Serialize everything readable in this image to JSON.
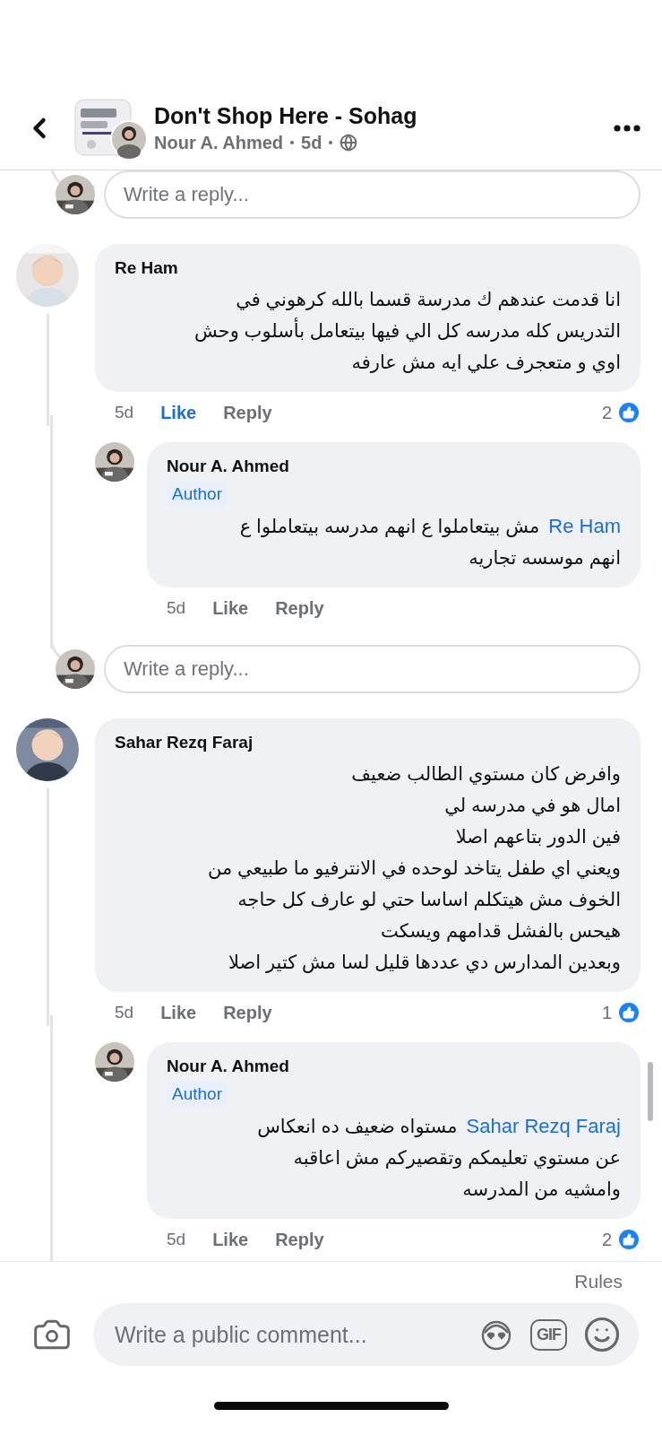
{
  "header": {
    "title": "Don't Shop Here - Sohag",
    "author": "Nour A. Ahmed",
    "time": "5d"
  },
  "thread": [
    {
      "kind": "reply_box",
      "placeholder": "Write a reply..."
    },
    {
      "kind": "comment",
      "name": "Re Ham",
      "text": "انا قدمت عندهم ك مدرسة قسما بالله كرهوني في\nالتدريس كله مدرسه كل الي فيها بيتعامل بأسلوب وحش\nاوي و متعجرف علي ايه مش عارفه",
      "time": "5d",
      "like": "Like",
      "liked": true,
      "reply": "Reply",
      "reactions": "2"
    },
    {
      "kind": "reply",
      "name": "Nour A. Ahmed",
      "badge": "Author",
      "mention": "Re Ham",
      "text": "مش بيتعاملوا ع انهم مدرسه بيتعاملوا ع\nانهم موسسه تجاريه",
      "time": "5d",
      "like": "Like",
      "liked": false,
      "reply": "Reply"
    },
    {
      "kind": "reply_box",
      "placeholder": "Write a reply..."
    },
    {
      "kind": "comment",
      "name": "Sahar Rezq Faraj",
      "text": "وافرض كان مستوي الطالب ضعيف\nامال هو في مدرسه لي\nفين الدور بتاعهم اصلا\nويعني اي طفل يتاخد لوحده في الانترفيو ما طبيعي من\nالخوف مش هيتكلم اساسا حتي لو عارف كل حاجه\nهيحس بالفشل قدامهم ويسكت\nوبعدين المدارس دي عددها قليل لسا مش كتير اصلا",
      "time": "5d",
      "like": "Like",
      "liked": false,
      "reply": "Reply",
      "reactions": "1"
    },
    {
      "kind": "reply",
      "name": "Nour A. Ahmed",
      "badge": "Author",
      "mention": "Sahar Rezq Faraj",
      "text": "مستواه ضعيف ده انعكاس\nعن مستوي تعليمكم وتقصيركم مش اعاقبه\nوامشيه من المدرسه",
      "time": "5d",
      "like": "Like",
      "liked": false,
      "reply": "Reply",
      "reactions": "2"
    }
  ],
  "composer": {
    "rules": "Rules",
    "placeholder": "Write a public comment...",
    "gif": "GIF"
  }
}
